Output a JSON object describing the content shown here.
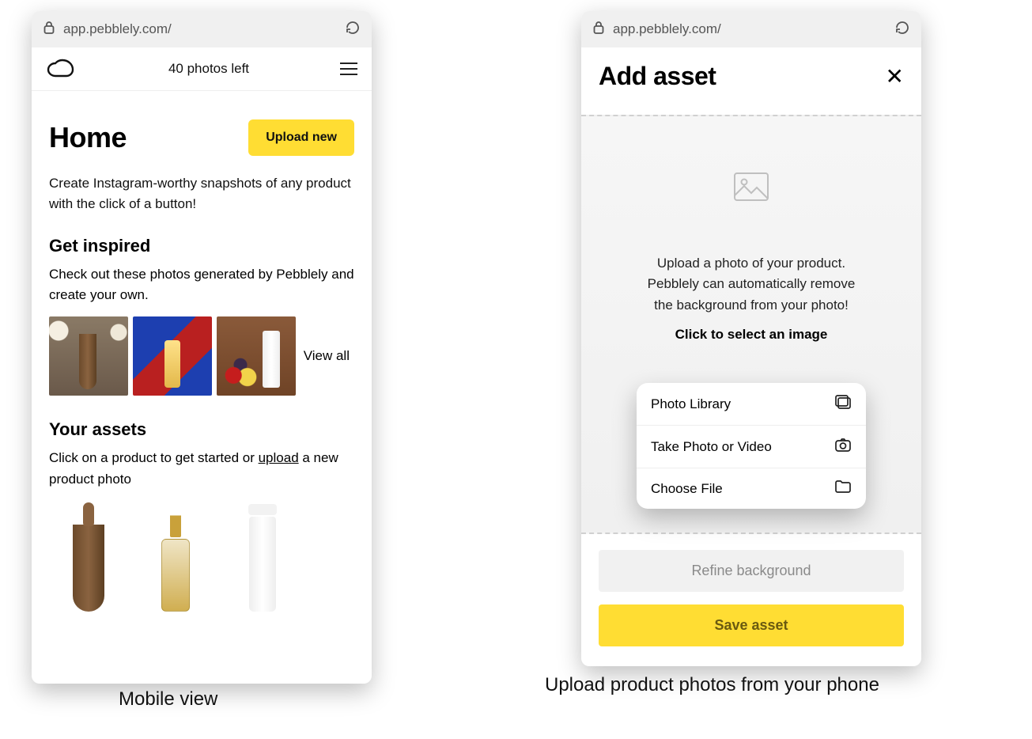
{
  "url": "app.pebblely.com/",
  "left": {
    "photos_left": "40 photos left",
    "home_title": "Home",
    "upload_btn": "Upload new",
    "tagline": "Create Instagram-worthy snapshots of any product with the click of a button!",
    "inspired_h": "Get inspired",
    "inspired_p": "Check out these photos generated by Pebblely and create your own.",
    "view_all": "View all",
    "assets_h": "Your assets",
    "assets_p_pre": "Click on a product to get started or ",
    "assets_p_link": "upload",
    "assets_p_post": " a new product photo",
    "caption": "Mobile view"
  },
  "right": {
    "title": "Add asset",
    "dz_line1": "Upload a photo of your product.",
    "dz_line2": "Pebblely can automatically remove",
    "dz_line3": "the background from your photo!",
    "dz_cta": "Click to select an image",
    "sheet": {
      "photo_library": "Photo Library",
      "take_photo": "Take Photo or Video",
      "choose_file": "Choose File"
    },
    "refine_btn": "Refine background",
    "save_btn": "Save asset",
    "caption": "Upload product photos from your phone"
  }
}
